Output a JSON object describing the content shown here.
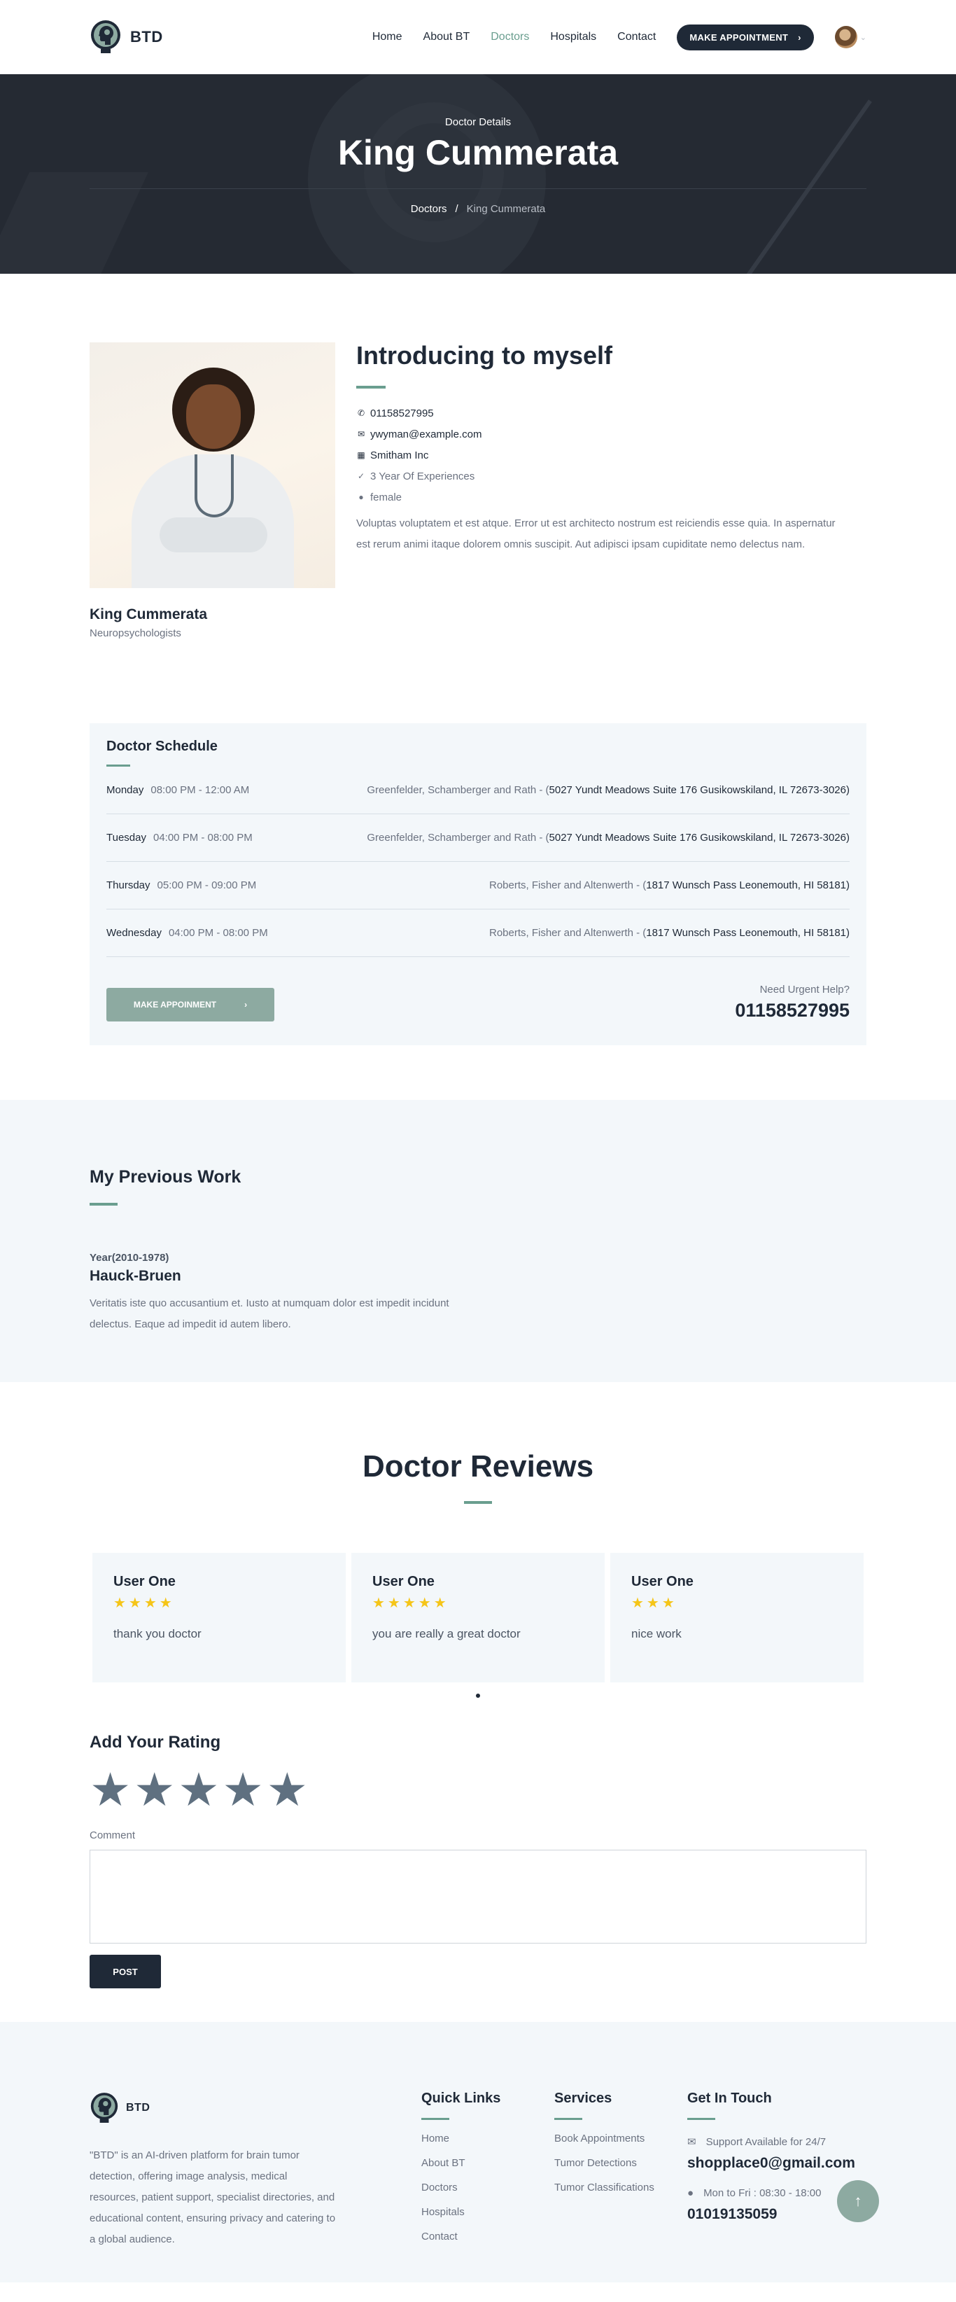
{
  "brand": {
    "name": "BTD"
  },
  "nav": {
    "items": [
      {
        "label": "Home",
        "active": false
      },
      {
        "label": "About BT",
        "active": false
      },
      {
        "label": "Doctors",
        "active": true
      },
      {
        "label": "Hospitals",
        "active": false
      },
      {
        "label": "Contact",
        "active": false
      }
    ],
    "cta_label": "MAKE APPOINTMENT",
    "cta_arrow": "›",
    "avatar_caret": "⌄"
  },
  "hero": {
    "subtitle": "Doctor Details",
    "title": "King Cummerata",
    "breadcrumb_root": "Doctors",
    "breadcrumb_sep": "/",
    "breadcrumb_current": "King Cummerata"
  },
  "profile": {
    "name": "King Cummerata",
    "specialty": "Neuropsychologists",
    "intro_heading": "Introducing to myself",
    "phone": "01158527995",
    "email": "ywyman@example.com",
    "organization": "Smitham Inc",
    "experience": "3 Year Of Experiences",
    "gender": "female",
    "bio": "Voluptas voluptatem et est atque. Error ut est architecto nostrum est reiciendis esse quia. In aspernatur est rerum animi itaque dolorem omnis suscipit. Aut adipisci ipsam cupiditate nemo delectus nam."
  },
  "schedule": {
    "heading": "Doctor Schedule",
    "rows": [
      {
        "day": "Monday",
        "time": "08:00 PM - 12:00 AM",
        "place": "Greenfelder, Schamberger and Rath - (",
        "address": "5027 Yundt Meadows Suite 176 Gusikowskiland, IL 72673-3026)"
      },
      {
        "day": "Tuesday",
        "time": "04:00 PM - 08:00 PM",
        "place": "Greenfelder, Schamberger and Rath - (",
        "address": "5027 Yundt Meadows Suite 176 Gusikowskiland, IL 72673-3026)"
      },
      {
        "day": "Thursday",
        "time": "05:00 PM - 09:00 PM",
        "place": "Roberts, Fisher and Altenwerth - (",
        "address": "1817 Wunsch Pass Leonemouth, HI 58181)"
      },
      {
        "day": "Wednesday",
        "time": "04:00 PM - 08:00 PM",
        "place": "Roberts, Fisher and Altenwerth - (",
        "address": "1817 Wunsch Pass Leonemouth, HI 58181)"
      }
    ],
    "button_label": "MAKE APPOINMENT",
    "button_arrow": "›",
    "urgent_label": "Need Urgent Help?",
    "urgent_phone": "01158527995"
  },
  "previous_work": {
    "heading": "My Previous Work",
    "year": "Year(2010-1978)",
    "company": "Hauck-Bruen",
    "description": "Veritatis iste quo accusantium et. Iusto at numquam dolor est impedit incidunt delectus. Eaque ad impedit id autem libero."
  },
  "reviews": {
    "heading": "Doctor Reviews",
    "items": [
      {
        "user": "User One",
        "stars": "★★★★",
        "rating": 4,
        "text": "thank you doctor"
      },
      {
        "user": "User One",
        "stars": "★★★★★",
        "rating": 5,
        "text": "you are really a great doctor"
      },
      {
        "user": "User One",
        "stars": "★★★",
        "rating": 3,
        "text": "nice work"
      }
    ]
  },
  "rating_form": {
    "heading": "Add Your Rating",
    "stars": [
      "★",
      "★",
      "★",
      "★",
      "★"
    ],
    "comment_label": "Comment",
    "post_label": "POST"
  },
  "footer": {
    "brand": "BTD",
    "about": "\"BTD\" is an AI-driven platform for brain tumor detection, offering image analysis, medical resources, patient support, specialist directories, and educational content, ensuring privacy and catering to a global audience.",
    "quick_links": {
      "heading": "Quick Links",
      "items": [
        "Home",
        "About BT",
        "Doctors",
        "Hospitals",
        "Contact"
      ]
    },
    "services": {
      "heading": "Services",
      "items": [
        "Book Appointments",
        "Tumor Detections",
        "Tumor Classifications"
      ]
    },
    "touch": {
      "heading": "Get In Touch",
      "support_label": "Support Available for 24/7",
      "email": "shopplace0@gmail.com",
      "hours_label": "Mon to Fri : 08:30 - 18:00",
      "phone": "01019135059"
    },
    "scroll_top_icon": "↑"
  },
  "colors": {
    "accent": "#6a9e8f",
    "dark": "#1f2937",
    "soft_bg": "#f3f7fa",
    "star": "#f5c518"
  }
}
